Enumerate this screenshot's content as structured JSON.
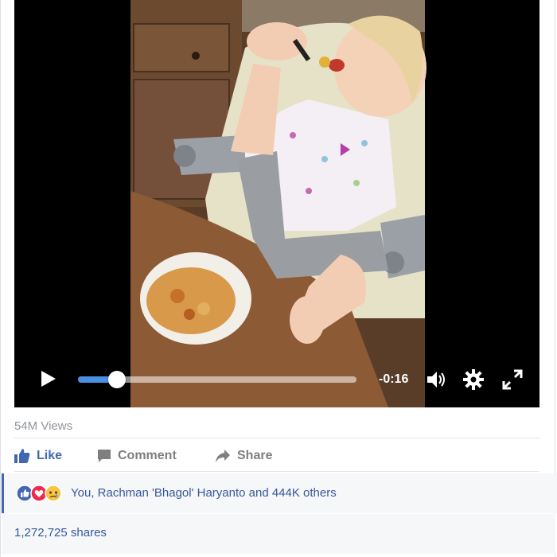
{
  "video": {
    "time_remaining": "-0:16",
    "progress": 0.14,
    "buffered": 0.9,
    "scene_description_icons": [
      "play-icon",
      "volume-icon",
      "settings-gear-icon",
      "fullscreen-icon"
    ]
  },
  "post": {
    "views": "54M Views",
    "actions": {
      "like": "Like",
      "comment": "Comment",
      "share": "Share"
    },
    "reactions_text": "You, Rachman 'Bhagol' Haryanto and 444K others",
    "shares_text": "1,272,725 shares"
  },
  "colors": {
    "like_blue": "#4267b2",
    "link_blue": "#365899",
    "gray_text": "#90949c",
    "progress_blue": "#4a90e2"
  }
}
